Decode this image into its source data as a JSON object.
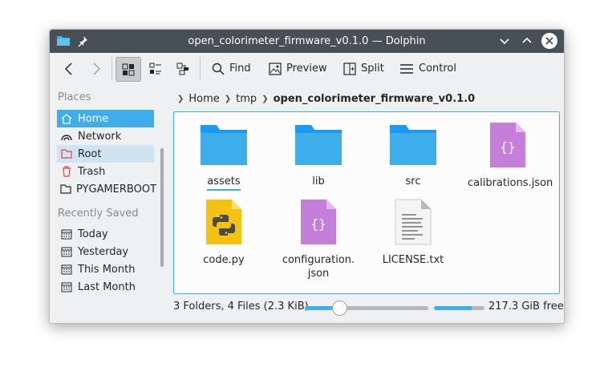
{
  "window": {
    "title": "open_colorimeter_firmware_v0.1.0 — Dolphin"
  },
  "toolbar": {
    "find_label": "Find",
    "preview_label": "Preview",
    "split_label": "Split",
    "control_label": "Control"
  },
  "sidebar": {
    "places_heading": "Places",
    "places": [
      {
        "label": "Home",
        "icon": "home-icon"
      },
      {
        "label": "Network",
        "icon": "network-icon"
      },
      {
        "label": "Root",
        "icon": "root-folder-icon"
      },
      {
        "label": "Trash",
        "icon": "trash-icon"
      },
      {
        "label": "PYGAMERBOOT",
        "icon": "drive-icon"
      }
    ],
    "recent_heading": "Recently Saved",
    "recent": [
      {
        "label": "Today",
        "icon": "calendar-icon"
      },
      {
        "label": "Yesterday",
        "icon": "calendar-icon"
      },
      {
        "label": "This Month",
        "icon": "calendar-icon"
      },
      {
        "label": "Last Month",
        "icon": "calendar-icon"
      }
    ]
  },
  "breadcrumb": {
    "items": [
      "Home",
      "tmp",
      "open_colorimeter_firmware_v0.1.0"
    ]
  },
  "files": [
    {
      "name": "assets",
      "type": "folder"
    },
    {
      "name": "lib",
      "type": "folder"
    },
    {
      "name": "src",
      "type": "folder"
    },
    {
      "name": "calibrations.json",
      "type": "json"
    },
    {
      "name": "code.py",
      "type": "python"
    },
    {
      "name": "configuration.json",
      "name_line1": "configuration.",
      "name_line2": "json",
      "type": "json"
    },
    {
      "name": "LICENSE.txt",
      "type": "text"
    }
  ],
  "status": {
    "summary": "3 Folders, 4 Files (2.3 KiB)",
    "zoom_fraction": 0.27,
    "free_space": "217.3 GiB free",
    "disk_used_fraction": 0.75
  },
  "colors": {
    "accent": "#3daee9",
    "titlebar": "#475057",
    "folder": "#3daee9",
    "json_file": "#c57fdb",
    "python_file": "#f5c211"
  }
}
